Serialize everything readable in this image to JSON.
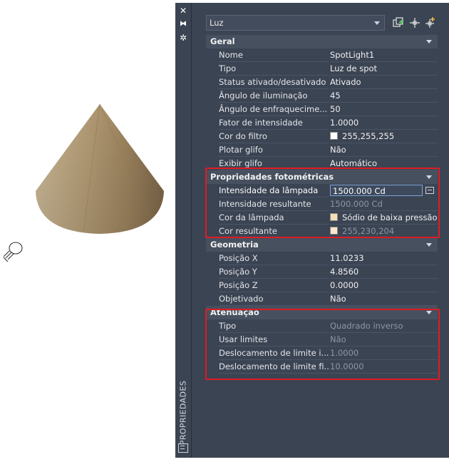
{
  "palette": {
    "title": "PROPRIEDADES",
    "selector": "Luz"
  },
  "sections": {
    "geral": {
      "title": "Geral",
      "rows": [
        {
          "label": "Nome",
          "value": "SpotLight1"
        },
        {
          "label": "Tipo",
          "value": "Luz de spot"
        },
        {
          "label": "Status ativado/desativado",
          "value": "Ativado"
        },
        {
          "label": "Ângulo de iluminação",
          "value": "45"
        },
        {
          "label": "Ângulo de enfraquecime...",
          "value": "50"
        },
        {
          "label": "Fator de intensidade",
          "value": "1.0000"
        },
        {
          "label": "Cor do filtro",
          "value": "255,255,255"
        },
        {
          "label": "Plotar glifo",
          "value": "Não"
        },
        {
          "label": "Exibir glifo",
          "value": "Automático"
        }
      ]
    },
    "fotometricas": {
      "title": "Propriedades fotométricas",
      "rows": [
        {
          "label": "Intensidade da lâmpada",
          "value": "1500.000 Cd"
        },
        {
          "label": "Intensidade resultante",
          "value": "1500.000 Cd"
        },
        {
          "label": "Cor da lâmpada",
          "value": "Sódio de baixa pressão"
        },
        {
          "label": "Cor resultante",
          "value": "255,230,204"
        }
      ]
    },
    "geometria": {
      "title": "Geometria",
      "rows": [
        {
          "label": "Posição X",
          "value": "11.0233"
        },
        {
          "label": "Posição Y",
          "value": "4.8560"
        },
        {
          "label": "Posição Z",
          "value": "0.0000"
        },
        {
          "label": "Objetivado",
          "value": "Não"
        }
      ]
    },
    "atenuacao": {
      "title": "Atenuação",
      "rows": [
        {
          "label": "Tipo",
          "value": "Quadrado inverso"
        },
        {
          "label": "Usar limites",
          "value": "Não"
        },
        {
          "label": "Deslocamento de limite i...",
          "value": "1.0000"
        },
        {
          "label": "Deslocamento de limite fi...",
          "value": "10.0000"
        }
      ]
    }
  },
  "colors": {
    "filter_swatch": "#ffffff",
    "lamp_swatch": "#f5dcb4",
    "resulting_swatch": "#ffe6cc",
    "highlight_border": "#e01b24",
    "panel_bg": "#3b4453"
  },
  "icons": {
    "close": "close-icon",
    "autohide": "autohide-icon",
    "settings": "gear-icon",
    "quick_select": "quick-select-icon",
    "select_objects": "select-objects-icon",
    "toggle_pickadd": "pickadd-icon"
  }
}
